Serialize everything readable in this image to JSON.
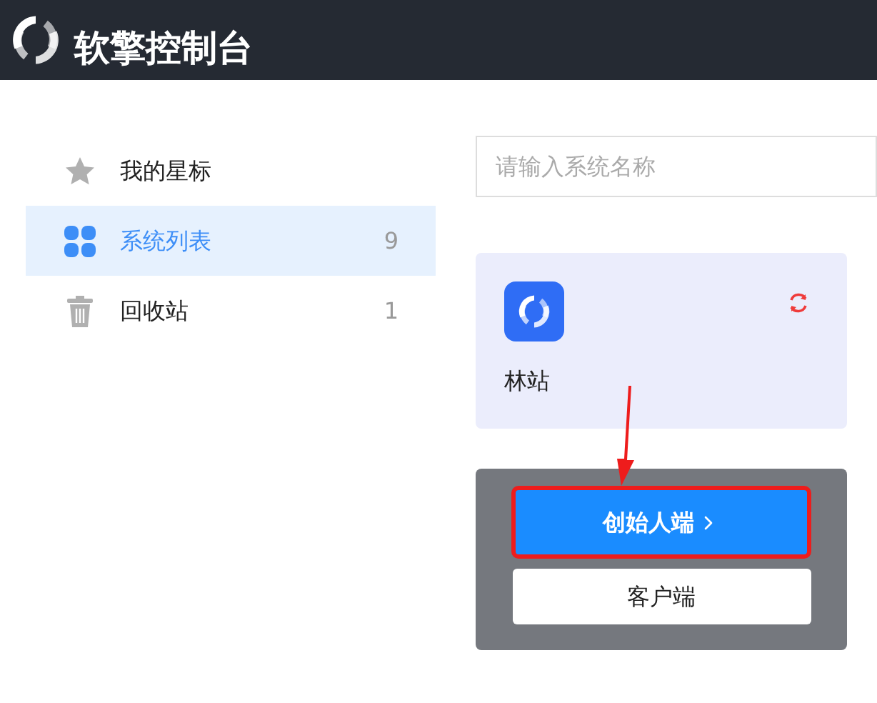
{
  "header": {
    "title": "软擎控制台"
  },
  "sidebar": {
    "items": [
      {
        "kind": "star",
        "label": "我的星标",
        "selected": false
      },
      {
        "kind": "grid",
        "label": "系统列表",
        "count": "9",
        "selected": true
      },
      {
        "kind": "trash",
        "label": "回收站",
        "count": "1",
        "selected": false
      }
    ]
  },
  "search": {
    "placeholder": "请输入系统名称"
  },
  "systems": [
    {
      "name": "林站"
    }
  ],
  "popup": {
    "buttons": [
      {
        "kind": "primary",
        "label": "创始人端"
      },
      {
        "kind": "secondary",
        "label": "客户端"
      }
    ]
  }
}
